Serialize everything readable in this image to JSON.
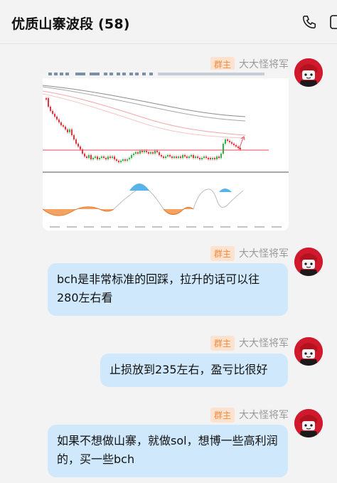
{
  "header": {
    "title": "优质山寨波段 (58)"
  },
  "messages": [
    {
      "badge": "群主",
      "sender": "大大怪将军",
      "type": "image"
    },
    {
      "badge": "群主",
      "sender": "大大怪将军",
      "type": "text",
      "text": "bch是非常标准的回踩，拉升的话可以往280左右看"
    },
    {
      "badge": "群主",
      "sender": "大大怪将军",
      "type": "text",
      "text": "止损放到235左右，盈亏比很好"
    },
    {
      "badge": "群主",
      "sender": "大大怪将军",
      "type": "text",
      "text": "如果不想做山寨，就做sol，想博一些高利润的，买一些bch"
    }
  ],
  "icons": {
    "call": "phone-icon",
    "more": "more-icon"
  },
  "colors": {
    "bubble": "#cfe8fb",
    "badge_bg": "#fde3cf",
    "badge_text": "#f08a3c",
    "avatar": "#d1192d"
  }
}
